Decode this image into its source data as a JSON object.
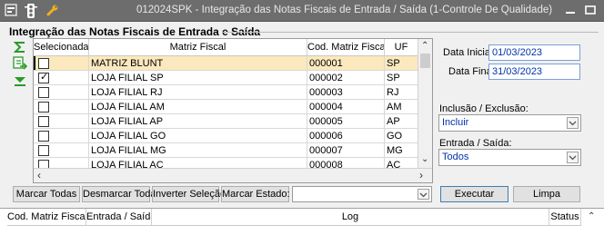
{
  "window": {
    "title": "012024SPK - Integração das Notas Fiscais de Entrada / Saída (1-Controle De Qualidade)",
    "titlebar_color": "#6d6d6d"
  },
  "section": {
    "title": "Integração das Notas Fiscais de Entrada e Saída"
  },
  "grid": {
    "columns": [
      "Selecionada",
      "Matriz Fiscal",
      "Cod. Matriz Fiscal",
      "UF"
    ],
    "rows": [
      {
        "checked": false,
        "matriz": "MATRIZ BLUNT",
        "codigo": "000001",
        "uf": "SP",
        "selected": true
      },
      {
        "checked": true,
        "matriz": "LOJA FILIAL SP",
        "codigo": "000002",
        "uf": "SP",
        "selected": false
      },
      {
        "checked": false,
        "matriz": "LOJA FILIAL RJ",
        "codigo": "000003",
        "uf": "RJ",
        "selected": false
      },
      {
        "checked": false,
        "matriz": "LOJA FILIAL AM",
        "codigo": "000004",
        "uf": "AM",
        "selected": false
      },
      {
        "checked": false,
        "matriz": "LOJA FILIAL AP",
        "codigo": "000005",
        "uf": "AP",
        "selected": false
      },
      {
        "checked": false,
        "matriz": "LOJA FILIAL GO",
        "codigo": "000006",
        "uf": "GO",
        "selected": false
      },
      {
        "checked": false,
        "matriz": "LOJA FILIAL MG",
        "codigo": "000007",
        "uf": "MG",
        "selected": false
      },
      {
        "checked": false,
        "matriz": "LOJA FILIAL AC",
        "codigo": "000008",
        "uf": "AC",
        "selected": false
      }
    ],
    "selected_row_color": "#fbe9bd"
  },
  "filters": {
    "data_inicial_label": "Data Inicial:",
    "data_inicial_value": "01/03/2023",
    "data_final_label": "Data Final:",
    "data_final_value": "31/03/2023",
    "inclusao_label": "Inclusão / Exclusão:",
    "inclusao_value": "Incluir",
    "entrada_label": "Entrada / Saída:",
    "entrada_value": "Todos"
  },
  "buttons": {
    "marcar_todas": "Marcar Todas",
    "desmarcar_todas": "Desmarcar Todas",
    "inverter_selecao": "Inverter Seleção",
    "marcar_estado": "Marcar Estado:",
    "marcar_estado_value": "",
    "executar": "Executar",
    "limpa": "Limpa"
  },
  "log_grid": {
    "columns": [
      "Cod. Matriz Fiscal",
      "Entrada / Saída",
      "Log",
      "Status"
    ]
  },
  "accent_color": "#0033aa"
}
